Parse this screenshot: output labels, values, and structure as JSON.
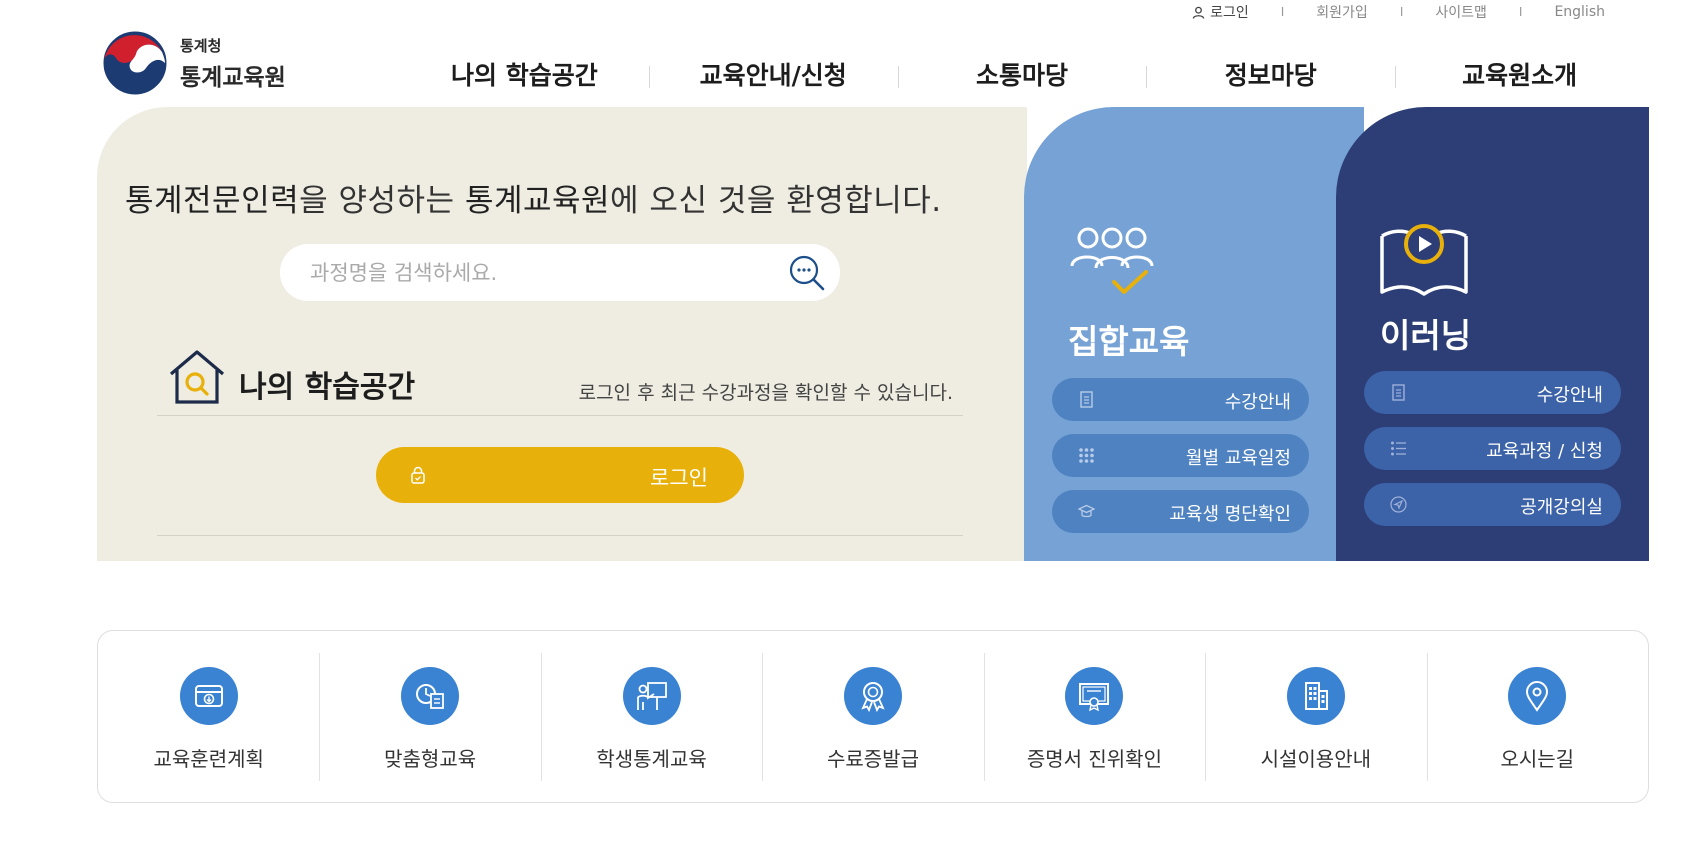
{
  "util": {
    "login": "로그인",
    "join": "회원가입",
    "sitemap": "사이트맵",
    "english": "English",
    "separator": "I"
  },
  "logo": {
    "small": "통계청",
    "big": "통계교육원"
  },
  "gnb": [
    "나의 학습공간",
    "교육안내/신청",
    "소통마당",
    "정보마당",
    "교육원소개"
  ],
  "hero": {
    "welcome_a": "통계전문인력",
    "welcome_b": "을 양성하는 ",
    "welcome_c": "통계교육원",
    "welcome_d": "에 오신 것을 환영합니다.",
    "search_placeholder": "과정명을 검색하세요.",
    "my_title": "나의 학습공간",
    "my_desc": "로그인 후 최근 수강과정을 확인할 수 있습니다.",
    "login_button": "로그인"
  },
  "group": {
    "title": "집합교육",
    "buttons": [
      "수강안내",
      "월별 교육일정",
      "교육생 명단확인"
    ]
  },
  "elearning": {
    "title": "이러닝",
    "buttons": [
      "수강안내",
      "교육과정 / 신청",
      "공개강의실"
    ]
  },
  "quick": [
    "교육훈련계획",
    "맞춤형교육",
    "학생통계교육",
    "수료증발급",
    "증명서 진위확인",
    "시설이용안내",
    "오시는길"
  ],
  "colors": {
    "hero_bg": "#efede2",
    "group_bg": "#76a2d6",
    "elearning_bg": "#2c3e75",
    "login_yellow": "#e8b00a",
    "quick_icon": "#3a82d2"
  },
  "icons": {
    "quick": [
      "calendar-download-icon",
      "clock-document-icon",
      "teacher-board-icon",
      "award-ribbon-icon",
      "certificate-icon",
      "building-icon",
      "location-pin-icon"
    ]
  }
}
